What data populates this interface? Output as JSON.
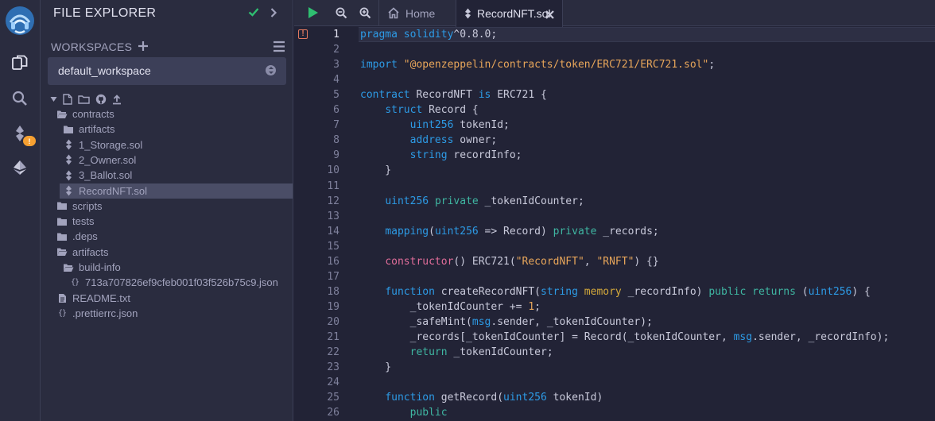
{
  "side_panel": {
    "title": "FILE EXPLORER",
    "workspaces_label": "WORKSPACES",
    "workspace_selected": "default_workspace"
  },
  "rail": {
    "badge_count": "!"
  },
  "file_tree": [
    {
      "label": "contracts",
      "type": "folder-open",
      "depth": 0,
      "selected": false
    },
    {
      "label": "artifacts",
      "type": "folder",
      "depth": 1,
      "selected": false
    },
    {
      "label": "1_Storage.sol",
      "type": "sol",
      "depth": 1,
      "selected": false
    },
    {
      "label": "2_Owner.sol",
      "type": "sol",
      "depth": 1,
      "selected": false
    },
    {
      "label": "3_Ballot.sol",
      "type": "sol",
      "depth": 1,
      "selected": false
    },
    {
      "label": "RecordNFT.sol",
      "type": "sol",
      "depth": 1,
      "selected": true
    },
    {
      "label": "scripts",
      "type": "folder",
      "depth": 0,
      "selected": false
    },
    {
      "label": "tests",
      "type": "folder",
      "depth": 0,
      "selected": false
    },
    {
      "label": ".deps",
      "type": "folder",
      "depth": 0,
      "selected": false
    },
    {
      "label": "artifacts",
      "type": "folder-open",
      "depth": 0,
      "selected": false
    },
    {
      "label": "build-info",
      "type": "folder-open",
      "depth": 1,
      "selected": false
    },
    {
      "label": "713a707826ef9cfeb001f03f526b75c9.json",
      "type": "json",
      "depth": 2,
      "selected": false
    },
    {
      "label": "README.txt",
      "type": "txt",
      "depth": 0,
      "selected": false
    },
    {
      "label": ".prettierrc.json",
      "type": "json",
      "depth": 0,
      "selected": false
    }
  ],
  "tabs": {
    "home": "Home",
    "active_file": "RecordNFT.sol"
  },
  "editor": {
    "active_line": 1,
    "lines": [
      [
        [
          "kw",
          "pragma solidity"
        ],
        [
          "",
          "^0.8.0;"
        ]
      ],
      [],
      [
        [
          "kw",
          "import"
        ],
        [
          "",
          ""
        ],
        [
          "str",
          "\"@openzeppelin/contracts/token/ERC721/ERC721.sol\""
        ],
        [
          "",
          ";"
        ]
      ],
      [],
      [
        [
          "kw",
          "contract"
        ],
        [
          "",
          " RecordNFT "
        ],
        [
          "kw",
          "is"
        ],
        [
          "",
          " ERC721 {"
        ]
      ],
      [
        [
          "",
          "    "
        ],
        [
          "kw",
          "struct"
        ],
        [
          "",
          " Record {"
        ]
      ],
      [
        [
          "",
          "        "
        ],
        [
          "kw",
          "uint256"
        ],
        [
          "",
          " tokenId;"
        ]
      ],
      [
        [
          "",
          "        "
        ],
        [
          "kw",
          "address"
        ],
        [
          "",
          " owner;"
        ]
      ],
      [
        [
          "",
          "        "
        ],
        [
          "kw",
          "string"
        ],
        [
          "",
          " recordInfo;"
        ]
      ],
      [
        [
          "",
          "    }"
        ]
      ],
      [],
      [
        [
          "",
          "    "
        ],
        [
          "kw",
          "uint256"
        ],
        [
          "",
          " "
        ],
        [
          "ret",
          "private"
        ],
        [
          "",
          " _tokenIdCounter;"
        ]
      ],
      [],
      [
        [
          "",
          "    "
        ],
        [
          "kw",
          "mapping"
        ],
        [
          "",
          "("
        ],
        [
          "kw",
          "uint256"
        ],
        [
          "",
          " => Record) "
        ],
        [
          "ret",
          "private"
        ],
        [
          "",
          " _records;"
        ]
      ],
      [],
      [
        [
          "",
          "    "
        ],
        [
          "pk",
          "constructor"
        ],
        [
          "",
          "() ERC721("
        ],
        [
          "str",
          "\"RecordNFT\""
        ],
        [
          "",
          ", "
        ],
        [
          "str",
          "\"RNFT\""
        ],
        [
          "",
          ") {}"
        ]
      ],
      [],
      [
        [
          "",
          "    "
        ],
        [
          "kw",
          "function"
        ],
        [
          "",
          " createRecordNFT("
        ],
        [
          "kw",
          "string"
        ],
        [
          "",
          " "
        ],
        [
          "mem",
          "memory"
        ],
        [
          "",
          " _recordInfo) "
        ],
        [
          "ret",
          "public"
        ],
        [
          "",
          " "
        ],
        [
          "ret",
          "returns"
        ],
        [
          "",
          " ("
        ],
        [
          "kw",
          "uint256"
        ],
        [
          "",
          ") {"
        ]
      ],
      [
        [
          "",
          "        _tokenIdCounter += "
        ],
        [
          "str",
          "1"
        ],
        [
          "",
          ";"
        ]
      ],
      [
        [
          "",
          "        _safeMint("
        ],
        [
          "kw",
          "msg"
        ],
        [
          "",
          ".sender, _tokenIdCounter);"
        ]
      ],
      [
        [
          "",
          "        _records[_tokenIdCounter] = Record(_tokenIdCounter, "
        ],
        [
          "kw",
          "msg"
        ],
        [
          "",
          ".sender, _recordInfo);"
        ]
      ],
      [
        [
          "",
          "        "
        ],
        [
          "ret",
          "return"
        ],
        [
          "",
          " _tokenIdCounter;"
        ]
      ],
      [
        [
          "",
          "    }"
        ]
      ],
      [],
      [
        [
          "",
          "    "
        ],
        [
          "kw",
          "function"
        ],
        [
          "",
          " getRecord("
        ],
        [
          "kw",
          "uint256"
        ],
        [
          "",
          " tokenId)"
        ]
      ],
      [
        [
          "",
          "        "
        ],
        [
          "ret",
          "public"
        ]
      ]
    ]
  }
}
